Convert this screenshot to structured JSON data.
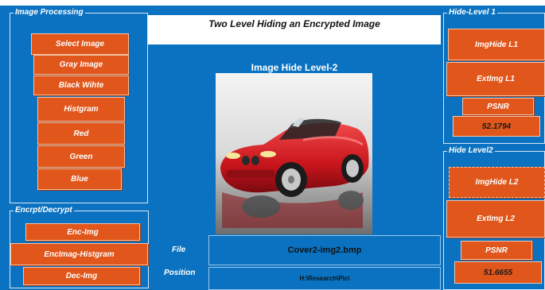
{
  "title": "Two Level Hiding an Encrypted Image",
  "subtitle": "Image Hide Level-2",
  "colors": {
    "background": "#0a72c0",
    "button": "#e0561b",
    "button_border": "#f7c4a8",
    "panel_border": "#d6e6f5"
  },
  "image_processing": {
    "title": "Image Processing",
    "buttons": [
      "Select Image",
      "Gray Image",
      "Black Wihte",
      "Histgram",
      "Red",
      "Green",
      "Blue"
    ]
  },
  "encrypt_decrypt": {
    "title": "Encrpt/Decrypt",
    "buttons": [
      "Enc-Img",
      "EncImag-Histgram",
      "Dec-Img"
    ]
  },
  "hide_level1": {
    "title": "Hide-Level 1",
    "hide_button": "ImgHide L1",
    "extract_button": "ExtImg L1",
    "psnr_label": "PSNR",
    "psnr_value": "52.1794"
  },
  "hide_level2": {
    "title": "Hide Level2",
    "hide_button": "ImgHide L2",
    "extract_button": "ExtImg L2",
    "psnr_label": "PSNR",
    "psnr_value": "51.6655"
  },
  "file": {
    "label": "File",
    "value": "Cover2-img2.bmp"
  },
  "position": {
    "label": "Position",
    "value": "H:\\Research\\Pic\\"
  }
}
